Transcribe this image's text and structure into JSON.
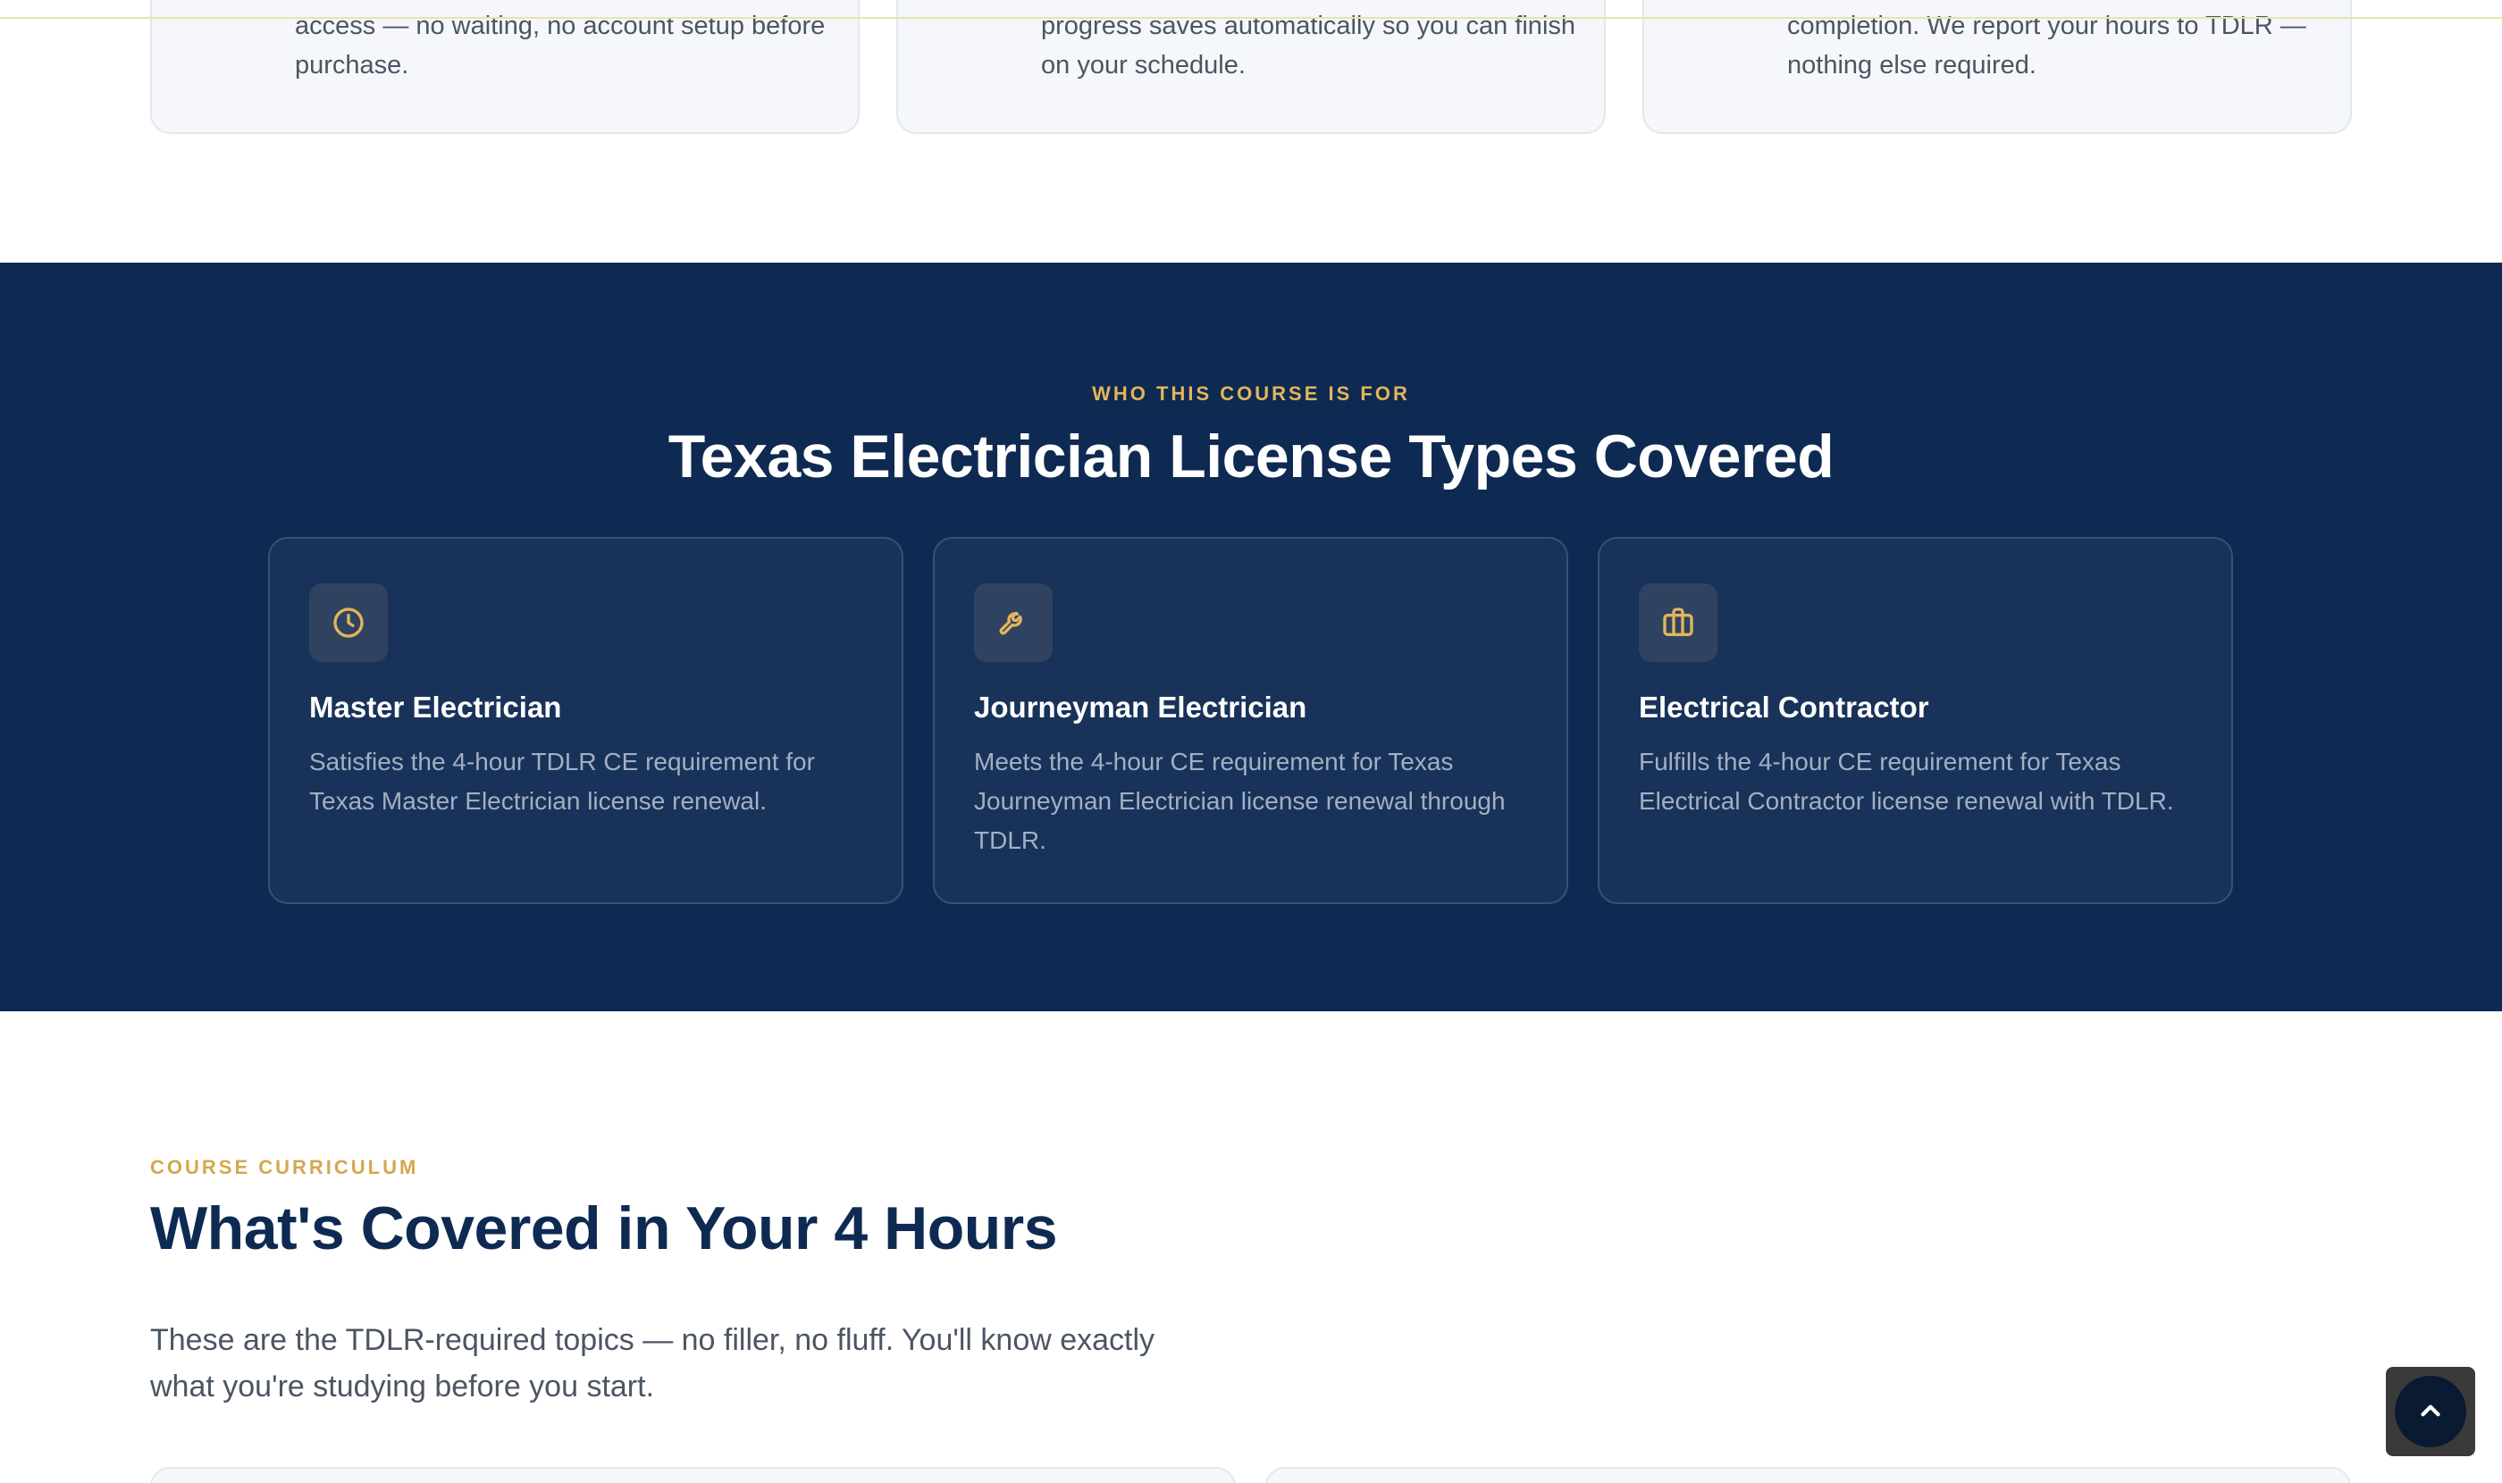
{
  "top_cards": [
    {
      "text": "access — no waiting, no account setup before purchase."
    },
    {
      "text": "progress saves automatically so you can finish on your schedule."
    },
    {
      "text": "completion. We report your hours to TDLR — nothing else required."
    }
  ],
  "audience": {
    "eyebrow": "WHO THIS COURSE IS FOR",
    "title": "Texas Electrician License Types Covered",
    "cards": [
      {
        "icon": "clock-icon",
        "title": "Master Electrician",
        "desc": "Satisfies the 4-hour TDLR CE requirement for Texas Master Electrician license renewal."
      },
      {
        "icon": "wrench-icon",
        "title": "Journeyman Electrician",
        "desc": "Meets the 4-hour CE requirement for Texas Journeyman Electrician license renewal through TDLR."
      },
      {
        "icon": "briefcase-icon",
        "title": "Electrical Contractor",
        "desc": "Fulfills the 4-hour CE requirement for Texas Electrical Contractor license renewal with TDLR."
      }
    ]
  },
  "curriculum": {
    "eyebrow": "COURSE CURRICULUM",
    "title": "What's Covered in Your 4 Hours",
    "desc": "These are the TDLR-required topics — no filler, no fluff. You'll know exactly what you're studying before you start."
  },
  "colors": {
    "navy": "#0e2a52",
    "gold": "#e3b55b",
    "card_navy": "#183259"
  },
  "back_to_top": {
    "icon": "chevron-up-icon"
  }
}
